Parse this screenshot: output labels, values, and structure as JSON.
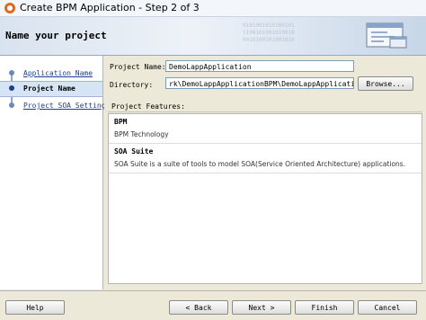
{
  "window": {
    "title": "Create BPM Application - Step 2 of 3"
  },
  "banner": {
    "heading": "Name your project",
    "watermark": "0101001010100101\n1100101001010010\n0010100101001010"
  },
  "sidebar": {
    "items": [
      {
        "label": "Application Name",
        "state": "link"
      },
      {
        "label": "Project Name",
        "state": "current"
      },
      {
        "label": "Project SOA Settings",
        "state": "link"
      }
    ]
  },
  "form": {
    "project_name_label": "Project Name:",
    "project_name_value": "DemoLappApplication",
    "directory_label": "Directory:",
    "directory_value": "rk\\DemoLappApplicationBPM\\DemoLappApplication",
    "browse_label": "Browse..."
  },
  "features": {
    "header": "Project Features:",
    "items": [
      {
        "name": "BPM",
        "description": "BPM Technology"
      },
      {
        "name": "SOA Suite",
        "description": "SOA Suite is a suite of tools to model SOA(Service Oriented Architecture) applications."
      }
    ]
  },
  "buttons": {
    "help": "Help",
    "back": "< Back",
    "next": "Next >",
    "finish": "Finish",
    "cancel": "Cancel"
  },
  "colors": {
    "accent": "#1d3f8c",
    "current_step_bg": "#d6e4f5",
    "dialog_bg": "#ece9d8"
  }
}
